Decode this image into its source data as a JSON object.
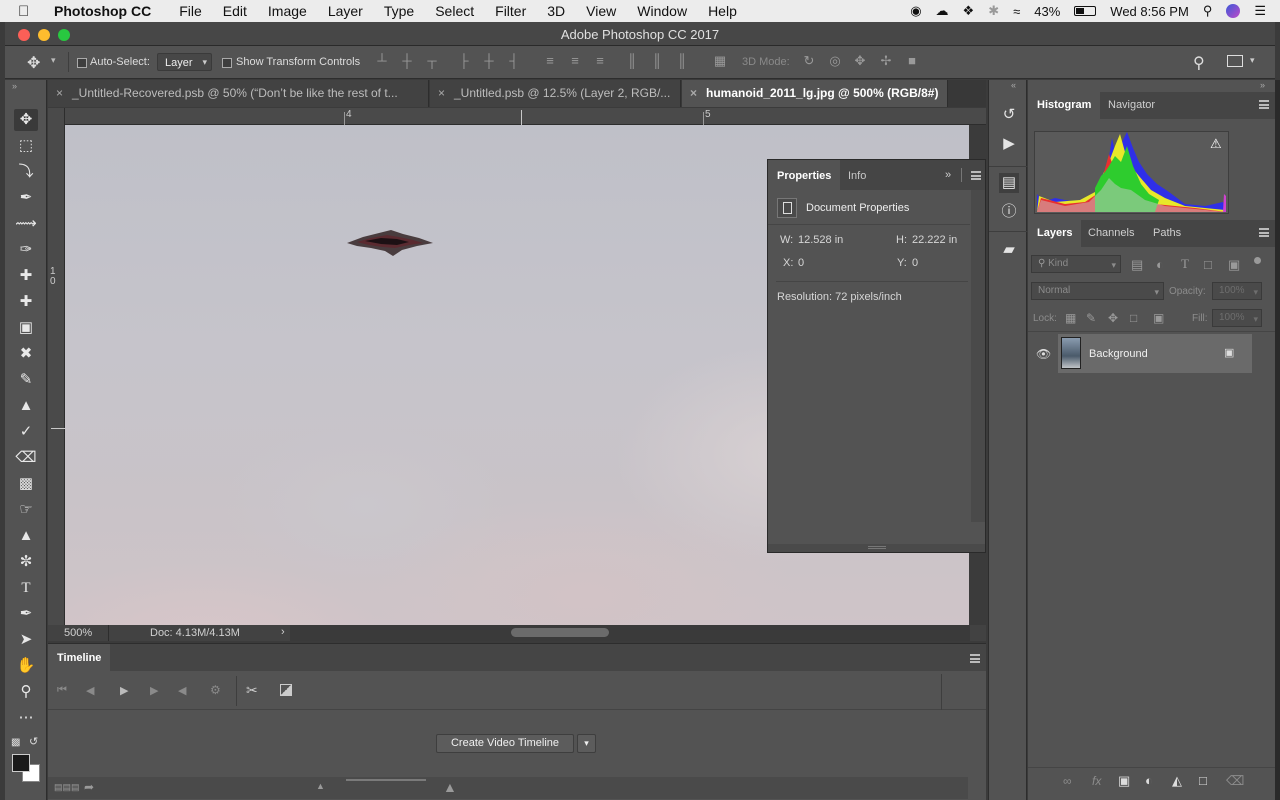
{
  "menubar": {
    "app_name": "Photoshop CC",
    "items": [
      "File",
      "Edit",
      "Image",
      "Layer",
      "Type",
      "Select",
      "Filter",
      "3D",
      "View",
      "Window",
      "Help"
    ],
    "battery": "43%",
    "clock": "Wed 8:56 PM"
  },
  "window": {
    "title": "Adobe Photoshop CC 2017"
  },
  "options": {
    "auto_select_label": "Auto-Select:",
    "auto_select_value": "Layer",
    "transform_label": "Show Transform Controls",
    "mode_3d_label": "3D Mode:"
  },
  "tabs": [
    {
      "label": "_Untitled-Recovered.psb @ 50% (“Don’t be like  the rest of t..."
    },
    {
      "label": "_Untitled.psb @ 12.5% (Layer 2, RGB/..."
    },
    {
      "label": "humanoid_2011_lg.jpg @ 500% (RGB/8#)"
    }
  ],
  "rulers": {
    "top_marks": [
      "4",
      "5"
    ],
    "left_marks": [
      "1",
      "0"
    ]
  },
  "status": {
    "zoom": "500%",
    "doc": "Doc: 4.13M/4.13M"
  },
  "properties": {
    "tabs": [
      "Properties",
      "Info"
    ],
    "section_title": "Document Properties",
    "w_label": "W:",
    "w_value": "12.528 in",
    "h_label": "H:",
    "h_value": "22.222 in",
    "x_label": "X:",
    "x_value": "0",
    "y_label": "Y:",
    "y_value": "0",
    "resolution": "Resolution: 72 pixels/inch"
  },
  "histogram_panel": {
    "tabs": [
      "Histogram",
      "Navigator"
    ]
  },
  "layers_panel": {
    "tabs": [
      "Layers",
      "Channels",
      "Paths"
    ],
    "kind_placeholder": "Kind",
    "blend_mode": "Normal",
    "opacity_label": "Opacity:",
    "opacity_value": "100%",
    "lock_label": "Lock:",
    "fill_label": "Fill:",
    "fill_value": "100%",
    "layers": [
      {
        "name": "Background"
      }
    ]
  },
  "timeline": {
    "title": "Timeline",
    "create_button": "Create Video Timeline"
  }
}
